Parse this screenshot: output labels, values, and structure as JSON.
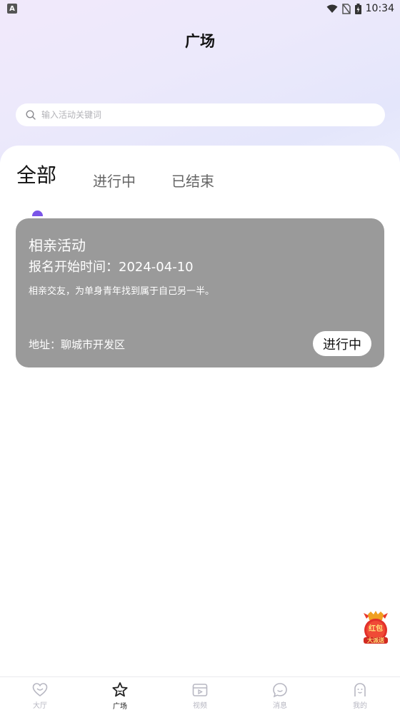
{
  "status_bar": {
    "left_badge": "A",
    "time": "10:34",
    "icons": [
      "wifi-icon",
      "no-sim-icon",
      "battery-icon"
    ]
  },
  "header": {
    "title": "广场"
  },
  "search": {
    "placeholder": "输入活动关键词",
    "value": ""
  },
  "tabs": [
    {
      "label": "全部",
      "active": true
    },
    {
      "label": "进行中",
      "active": false
    },
    {
      "label": "已结束",
      "active": false
    }
  ],
  "activities": [
    {
      "title": "相亲活动",
      "start_time_label": "报名开始时间：2024-04-10",
      "description": "相亲交友，为单身青年找到属于自己另一半。",
      "address_label": "地址：聊城市开发区",
      "status": "进行中"
    }
  ],
  "float_badge": {
    "text_line1": "红包",
    "text_line2": "大派送"
  },
  "bottom_nav": [
    {
      "label": "大厅",
      "icon": "heart-icon",
      "active": false
    },
    {
      "label": "广场",
      "icon": "star-icon",
      "active": true
    },
    {
      "label": "视频",
      "icon": "video-icon",
      "active": false
    },
    {
      "label": "消息",
      "icon": "chat-icon",
      "active": false
    },
    {
      "label": "我的",
      "icon": "profile-icon",
      "active": false
    }
  ],
  "colors": {
    "accent": "#7a55e8",
    "card_bg": "#9a9a9a",
    "nav_inactive": "#b7b7c2"
  }
}
